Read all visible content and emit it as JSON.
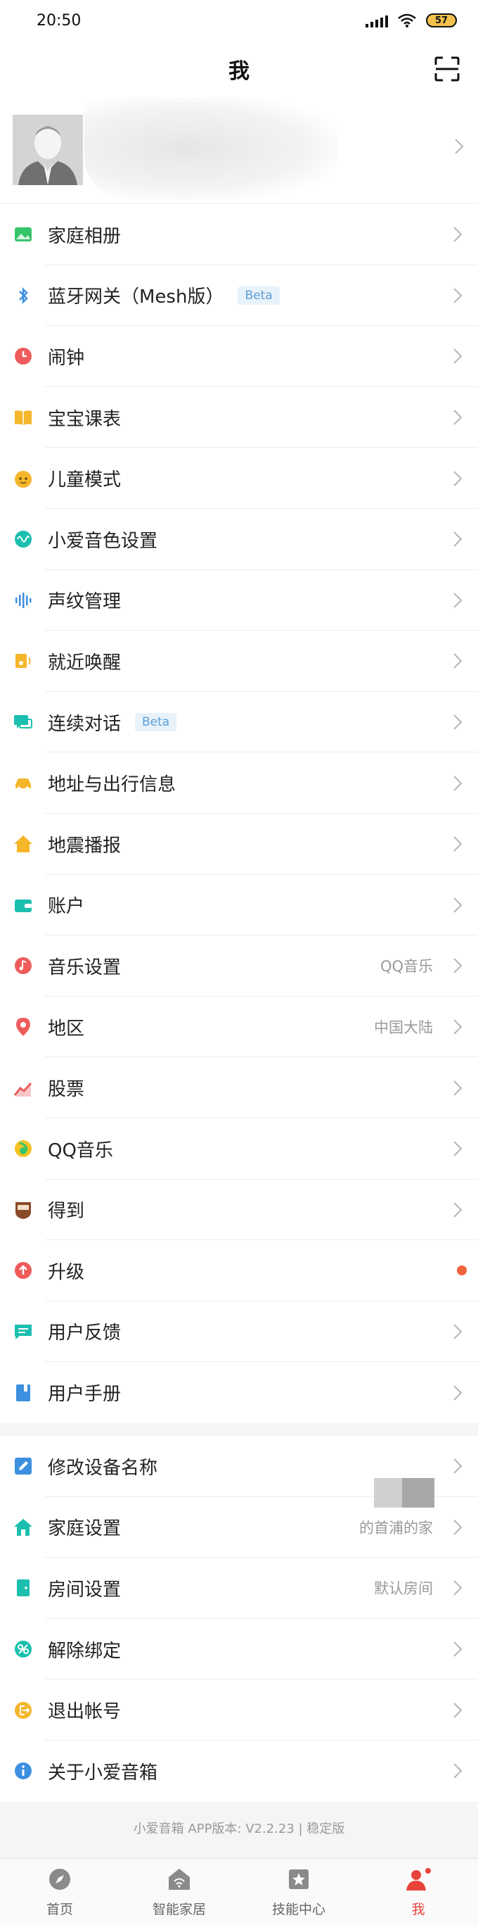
{
  "status_bar": {
    "time": "20:50",
    "battery": "57"
  },
  "header": {
    "title": "我"
  },
  "menu_group_1": [
    {
      "label": "家庭相册",
      "icon": "photo-album-icon",
      "color": "#35c46a"
    },
    {
      "label": "蓝牙网关（Mesh版）",
      "badge": "Beta",
      "icon": "bluetooth-icon",
      "color": "#3d8fe0"
    },
    {
      "label": "闹钟",
      "icon": "alarm-clock-icon",
      "color": "#ef5b5b"
    },
    {
      "label": "宝宝课表",
      "icon": "book-icon",
      "color": "#f5b62a"
    },
    {
      "label": "儿童模式",
      "icon": "child-face-icon",
      "color": "#f5b62a"
    },
    {
      "label": "小爱音色设置",
      "icon": "voice-wave-icon",
      "color": "#1bbfae"
    },
    {
      "label": "声纹管理",
      "icon": "voiceprint-icon",
      "color": "#3d8fe0"
    },
    {
      "label": "就近唤醒",
      "icon": "nearby-wake-icon",
      "color": "#f5b62a"
    },
    {
      "label": "连续对话",
      "badge": "Beta",
      "icon": "chat-icon",
      "color": "#1bbfae"
    },
    {
      "label": "地址与出行信息",
      "icon": "car-icon",
      "color": "#f5b62a"
    },
    {
      "label": "地震播报",
      "icon": "house-icon",
      "color": "#f5b62a"
    },
    {
      "label": "账户",
      "icon": "wallet-icon",
      "color": "#1bbfae"
    },
    {
      "label": "音乐设置",
      "value": "QQ音乐",
      "icon": "music-icon",
      "color": "#ef5b5b"
    },
    {
      "label": "地区",
      "value": "中国大陆",
      "icon": "location-pin-icon",
      "color": "#ef5b5b"
    },
    {
      "label": "股票",
      "icon": "stock-chart-icon",
      "color": "#ef5b5b"
    },
    {
      "label": "QQ音乐",
      "icon": "qq-music-icon",
      "color": "#35c46a"
    },
    {
      "label": "得到",
      "icon": "dedao-icon",
      "color": "#8b4a2a"
    },
    {
      "label": "升级",
      "icon": "upgrade-icon",
      "color": "#ef5b5b",
      "dot": true
    },
    {
      "label": "用户反馈",
      "icon": "feedback-icon",
      "color": "#1bbfae"
    },
    {
      "label": "用户手册",
      "icon": "manual-icon",
      "color": "#3d8fe0"
    }
  ],
  "menu_group_2": [
    {
      "label": "修改设备名称",
      "icon": "edit-icon",
      "color": "#3d8fe0"
    },
    {
      "label": "家庭设置",
      "value": "的首浦的家",
      "icon": "home-icon",
      "color": "#1bbfae"
    },
    {
      "label": "房间设置",
      "value": "默认房间",
      "icon": "room-door-icon",
      "color": "#1bbfae"
    },
    {
      "label": "解除绑定",
      "icon": "unbind-icon",
      "color": "#1bbfae"
    },
    {
      "label": "退出帐号",
      "icon": "logout-icon",
      "color": "#f5b62a"
    },
    {
      "label": "关于小爱音箱",
      "icon": "info-icon",
      "color": "#3d8fe0"
    }
  ],
  "version_text": "小爱音箱 APP版本: V2.2.23 | 稳定版",
  "tabs": [
    {
      "label": "首页",
      "icon": "compass-icon"
    },
    {
      "label": "智能家居",
      "icon": "smart-home-icon"
    },
    {
      "label": "技能中心",
      "icon": "skill-star-icon"
    },
    {
      "label": "我",
      "icon": "profile-icon",
      "active": true
    }
  ],
  "colors": {
    "accent_red": "#e8433a",
    "chevron": "#b5b5b5"
  }
}
